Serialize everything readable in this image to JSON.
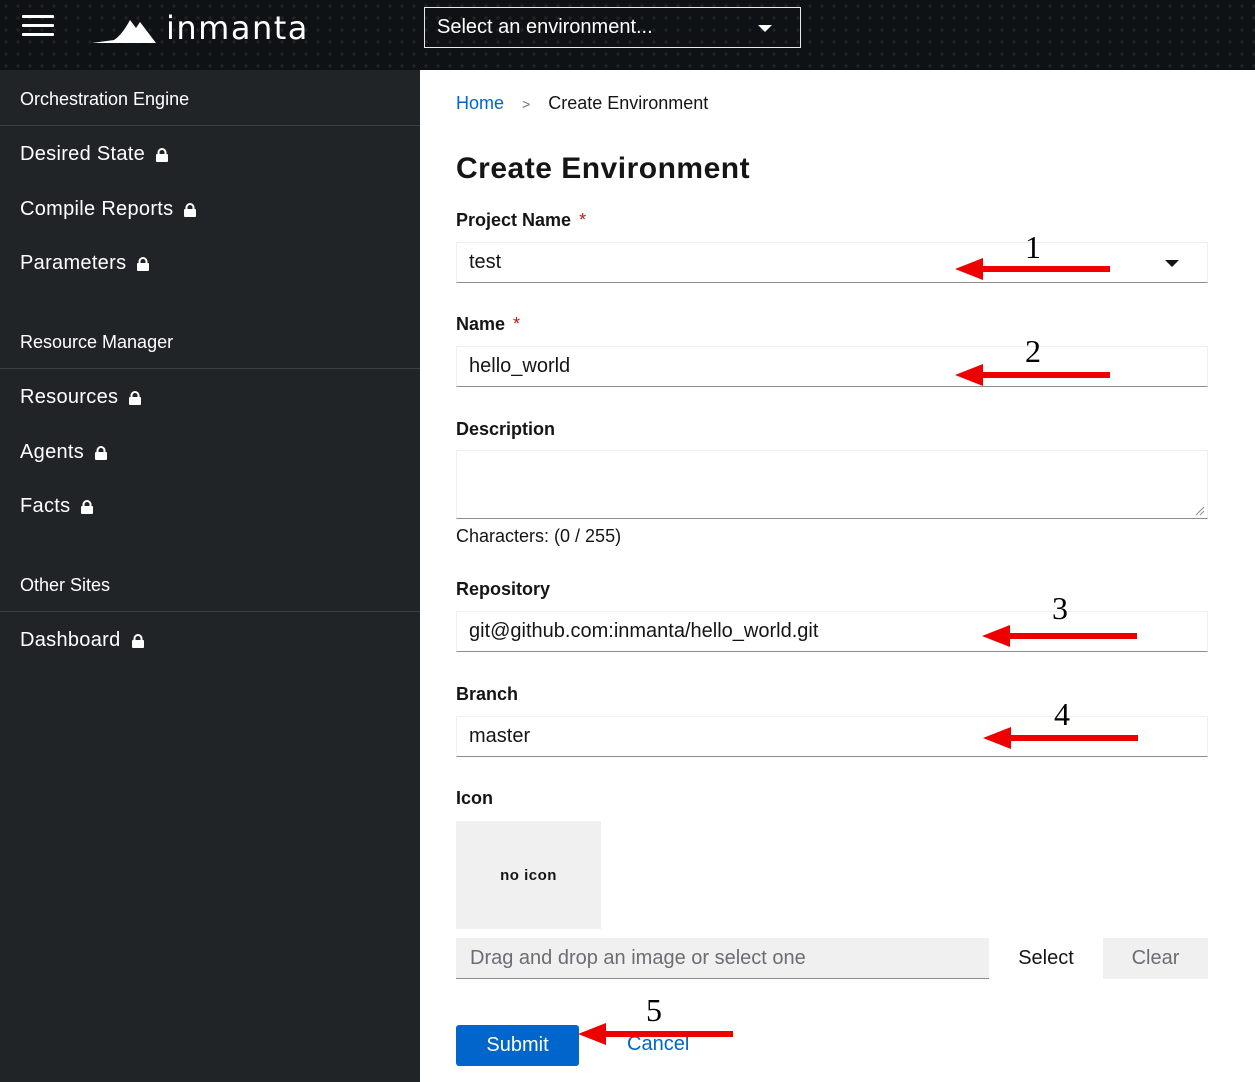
{
  "header": {
    "logo_text": "inmanta",
    "env_selector": "Select an environment..."
  },
  "sidebar": {
    "sections": [
      {
        "title": "Orchestration Engine",
        "items": [
          {
            "label": "Desired State"
          },
          {
            "label": "Compile Reports"
          },
          {
            "label": "Parameters"
          }
        ]
      },
      {
        "title": "Resource Manager",
        "items": [
          {
            "label": "Resources"
          },
          {
            "label": "Agents"
          },
          {
            "label": "Facts"
          }
        ]
      },
      {
        "title": "Other Sites",
        "items": [
          {
            "label": "Dashboard"
          }
        ]
      }
    ]
  },
  "breadcrumb": {
    "home": "Home",
    "separator": ">",
    "current": "Create Environment"
  },
  "form": {
    "title": "Create Environment",
    "required_mark": "*",
    "project_name": {
      "label": "Project Name",
      "value": "test"
    },
    "name": {
      "label": "Name",
      "value": "hello_world"
    },
    "description": {
      "label": "Description",
      "value": "",
      "helper": "Characters: (0 / 255)"
    },
    "repository": {
      "label": "Repository",
      "value": "git@github.com:inmanta/hello_world.git"
    },
    "branch": {
      "label": "Branch",
      "value": "master"
    },
    "icon": {
      "label": "Icon",
      "preview_text": "no icon",
      "file_placeholder": "Drag and drop an image or select one",
      "select_label": "Select",
      "clear_label": "Clear"
    },
    "submit_label": "Submit",
    "cancel_label": "Cancel"
  },
  "annotations": [
    "1",
    "2",
    "3",
    "4",
    "5"
  ],
  "colors": {
    "header_bg": "#0f1214",
    "sidebar_bg": "#212427",
    "primary": "#0066cc",
    "required": "#c9190b",
    "arrow": "#ee0000"
  }
}
